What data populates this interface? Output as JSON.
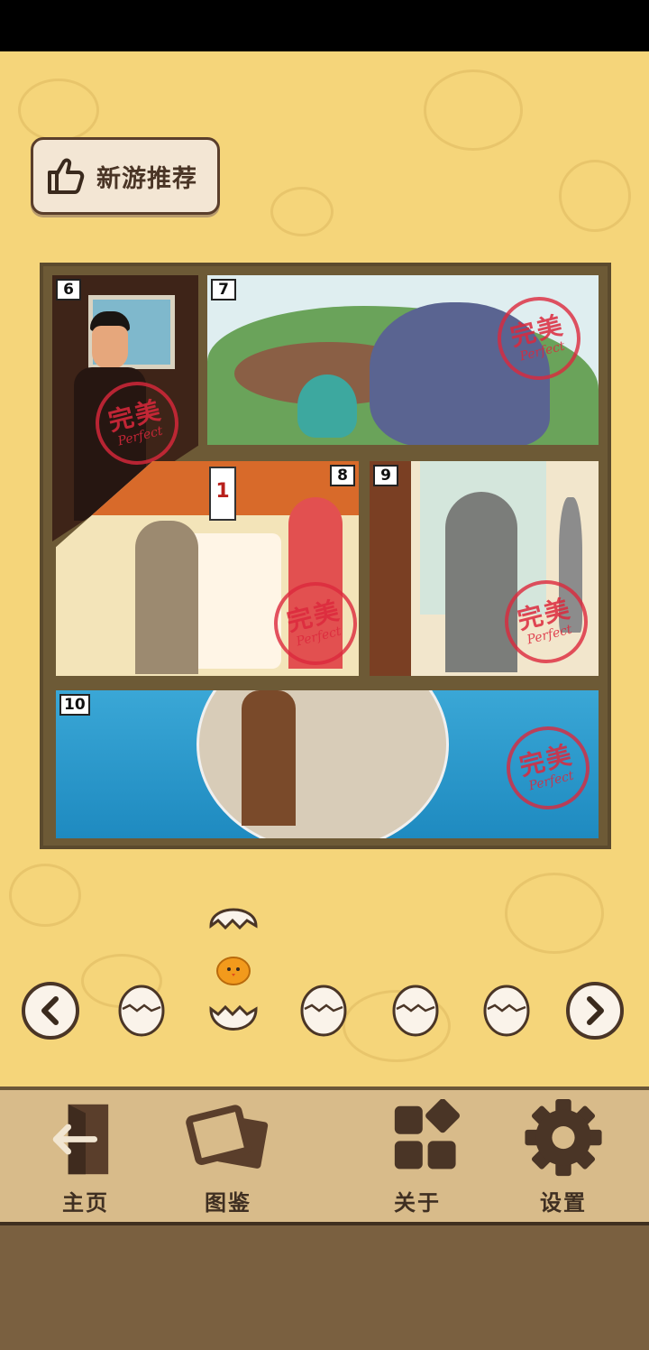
{
  "promo": {
    "label": "新游推荐",
    "icon": "thumbs-up-icon"
  },
  "comic": {
    "panels": [
      {
        "number": "6",
        "stamp": true
      },
      {
        "number": "7",
        "stamp": true
      },
      {
        "number": "8",
        "stamp": true
      },
      {
        "number": "9",
        "stamp": true
      },
      {
        "number": "10",
        "stamp": true
      }
    ],
    "stamp": {
      "text_cn": "完美",
      "text_en": "Perfect"
    },
    "door_sign": "1"
  },
  "level_selector": {
    "prev_icon": "chevron-left-icon",
    "next_icon": "chevron-right-icon",
    "eggs": [
      {
        "state": "closed"
      },
      {
        "state": "hatched-current"
      },
      {
        "state": "closed"
      },
      {
        "state": "closed"
      },
      {
        "state": "closed"
      }
    ]
  },
  "bottom_nav": [
    {
      "label": "主页",
      "icon": "exit-door-icon"
    },
    {
      "label": "图鉴",
      "icon": "gallery-cards-icon"
    },
    {
      "label": "关于",
      "icon": "grid-shapes-icon"
    },
    {
      "label": "设置",
      "icon": "gear-icon"
    }
  ],
  "colors": {
    "background": "#f5d57a",
    "frame": "#5b4a2d",
    "stamp": "#dc283c",
    "nav_bar": "#d8bb8a",
    "text": "#4a3526"
  }
}
